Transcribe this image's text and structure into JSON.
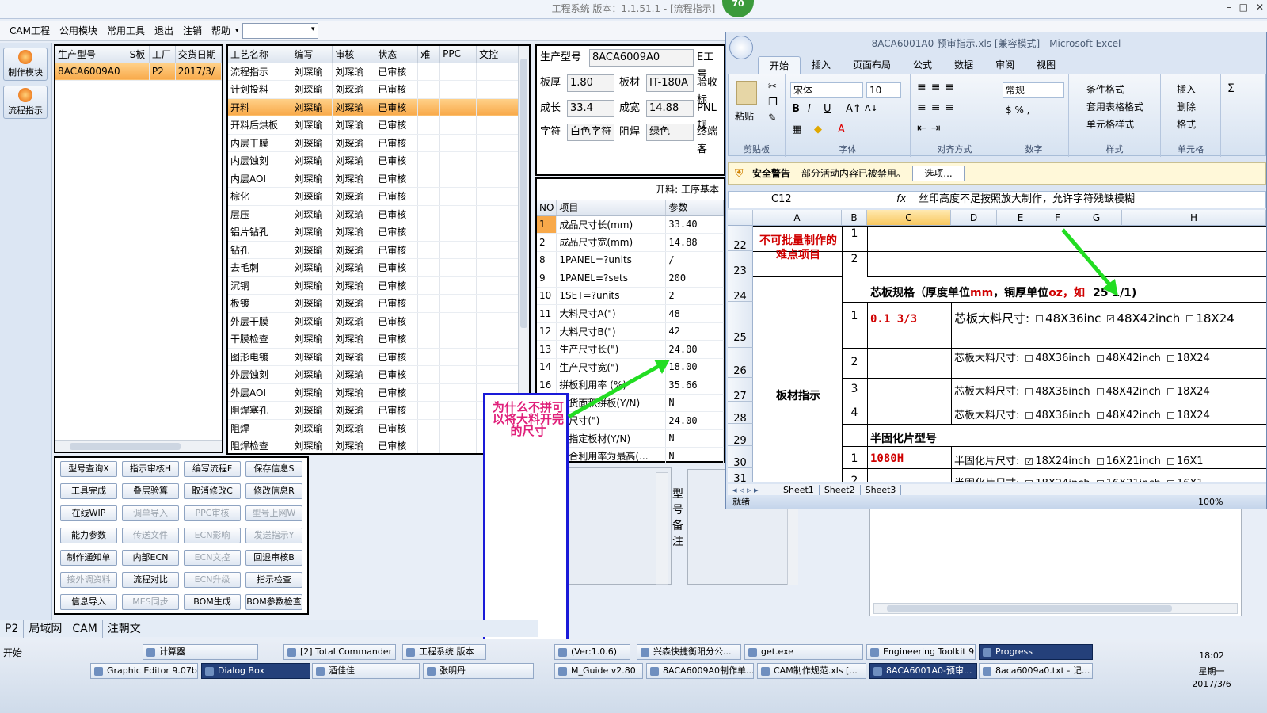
{
  "app": {
    "title": "工程系统   版本：1.1.51.1 - [流程指示]",
    "badge": "70",
    "win_controls": [
      "–",
      "□",
      "✕"
    ]
  },
  "menu": {
    "items": [
      "CAM工程",
      "公用模块",
      "常用工具",
      "退出",
      "注销",
      "帮助"
    ],
    "dropdown_arrow": "▾",
    "combo_value": ""
  },
  "left_buttons": [
    {
      "label": "制作模块"
    },
    {
      "label": "流程指示"
    }
  ],
  "order_grid": {
    "headers": [
      "生产型号",
      "S板",
      "工厂",
      "交货日期"
    ],
    "rows": [
      [
        "8ACA6009A0",
        "",
        "P2",
        "2017/3/"
      ]
    ]
  },
  "process_grid": {
    "headers": [
      "工艺名称",
      "编写",
      "审核",
      "状态",
      "难",
      "PPC",
      "文控"
    ],
    "rows": [
      [
        "流程指示",
        "刘琛瑜",
        "刘琛瑜",
        "已审核"
      ],
      [
        "计划投料",
        "刘琛瑜",
        "刘琛瑜",
        "已审核"
      ],
      [
        "开料",
        "刘琛瑜",
        "刘琛瑜",
        "已审核"
      ],
      [
        "开料后烘板",
        "刘琛瑜",
        "刘琛瑜",
        "已审核"
      ],
      [
        "内层干膜",
        "刘琛瑜",
        "刘琛瑜",
        "已审核"
      ],
      [
        "内层蚀刻",
        "刘琛瑜",
        "刘琛瑜",
        "已审核"
      ],
      [
        "内层AOI",
        "刘琛瑜",
        "刘琛瑜",
        "已审核"
      ],
      [
        "棕化",
        "刘琛瑜",
        "刘琛瑜",
        "已审核"
      ],
      [
        "层压",
        "刘琛瑜",
        "刘琛瑜",
        "已审核"
      ],
      [
        "铝片钻孔",
        "刘琛瑜",
        "刘琛瑜",
        "已审核"
      ],
      [
        "钻孔",
        "刘琛瑜",
        "刘琛瑜",
        "已审核"
      ],
      [
        "去毛刺",
        "刘琛瑜",
        "刘琛瑜",
        "已审核"
      ],
      [
        "沉铜",
        "刘琛瑜",
        "刘琛瑜",
        "已审核"
      ],
      [
        "板镀",
        "刘琛瑜",
        "刘琛瑜",
        "已审核"
      ],
      [
        "外层干膜",
        "刘琛瑜",
        "刘琛瑜",
        "已审核"
      ],
      [
        "干膜检查",
        "刘琛瑜",
        "刘琛瑜",
        "已审核"
      ],
      [
        "图形电镀",
        "刘琛瑜",
        "刘琛瑜",
        "已审核"
      ],
      [
        "外层蚀刻",
        "刘琛瑜",
        "刘琛瑜",
        "已审核"
      ],
      [
        "外层AOI",
        "刘琛瑜",
        "刘琛瑜",
        "已审核"
      ],
      [
        "阻焊塞孔",
        "刘琛瑜",
        "刘琛瑜",
        "已审核"
      ],
      [
        "阻焊",
        "刘琛瑜",
        "刘琛瑜",
        "已审核"
      ],
      [
        "阻焊检查",
        "刘琛瑜",
        "刘琛瑜",
        "已审核"
      ]
    ],
    "selected_index": 2
  },
  "buttons": [
    [
      "型号查询X",
      "指示审核H",
      "编写流程F",
      "保存信息S"
    ],
    [
      "工具完成",
      "叠层验算",
      "取消修改C",
      "修改信息R"
    ],
    [
      "在线WIP",
      "调单导入",
      "PPC审核",
      "型号上网W"
    ],
    [
      "能力参数",
      "传送文件",
      "ECN影响",
      "发送指示Y"
    ],
    [
      "制作通知单",
      "内部ECN",
      "ECN文控",
      "回退审核B"
    ],
    [
      "接外调资料",
      "流程对比",
      "ECN升级",
      "指示检查"
    ],
    [
      "信息导入",
      "MES同步",
      "BOM生成",
      "BOM参数检查"
    ]
  ],
  "disabled_buttons": [
    "调单导入",
    "PPC审核",
    "型号上网W",
    "传送文件",
    "ECN影响",
    "发送指示Y",
    "ECN文控",
    "接外调资料",
    "ECN升级",
    "MES同步"
  ],
  "info": {
    "prod_label": "生产型号",
    "prod_value": "8ACA6009A0",
    "e_label": "E工号",
    "thick_label": "板厚",
    "thick_value": "1.80",
    "mat_label": "板材",
    "mat_value": "IT-180A",
    "check_label": "验收标",
    "len_label": "成长",
    "len_value": "33.4",
    "wid_label": "成宽",
    "wid_value": "14.88",
    "pnl_label": "PNL规",
    "char_label": "字符",
    "char_value": "白色字符",
    "mask_label": "阻焊",
    "mask_value": "绿色",
    "end_label": "终端客"
  },
  "param_grid": {
    "title": "开料: 工序基本",
    "headers": [
      "NO",
      "项目",
      "参数"
    ],
    "rows": [
      [
        "1",
        "成品尺寸长(mm)",
        "33.40"
      ],
      [
        "2",
        "成品尺寸宽(mm)",
        "14.88"
      ],
      [
        "8",
        "1PANEL=?units",
        "/"
      ],
      [
        "9",
        "1PANEL=?sets",
        "200"
      ],
      [
        "10",
        "1SET=?units",
        "2"
      ],
      [
        "11",
        "大料尺寸A(\")",
        "48"
      ],
      [
        "12",
        "大料尺寸B(\")",
        "42"
      ],
      [
        "13",
        "生产尺寸长(\")",
        "24.00"
      ],
      [
        "14",
        "生产尺寸宽(\")",
        "18.00"
      ],
      [
        "16",
        "拼板利用率 (%)",
        "35.66"
      ],
      [
        "",
        "交货面积拼板(Y/N)",
        "N"
      ],
      [
        "",
        "间尺寸(\")",
        "24.00"
      ],
      [
        "",
        "客指定板材(Y/N)",
        "N"
      ],
      [
        "",
        "综合利用率为最高(...",
        "N"
      ]
    ],
    "selected_index": 0
  },
  "remarks_label": "型号备注",
  "excel": {
    "title": "8ACA6001A0-预审指示.xls  [兼容模式] - Microsoft Excel",
    "tabs": [
      "开始",
      "插入",
      "页面布局",
      "公式",
      "数据",
      "审阅",
      "视图"
    ],
    "groups": [
      "剪贴板",
      "字体",
      "对齐方式",
      "数字",
      "样式",
      "单元格"
    ],
    "paste": "粘贴",
    "font_name": "宋体",
    "font_size": "10",
    "num_format": "常规",
    "style_items": [
      "条件格式",
      "套用表格格式",
      "单元格样式"
    ],
    "cell_items": [
      "插入",
      "删除",
      "格式"
    ],
    "security_title": "安全警告",
    "security_text": "部分活动内容已被禁用。",
    "options_btn": "选项...",
    "name_box": "C12",
    "fx": "fx",
    "formula": "丝印高度不足按照放大制作，允许字符残缺模糊",
    "cols": [
      "A",
      "B",
      "C",
      "D",
      "E",
      "F",
      "G",
      "H"
    ],
    "rows": [
      "22",
      "23",
      "24",
      "25",
      "26",
      "27",
      "28",
      "29",
      "30",
      "31"
    ],
    "a_difficult": "不可批量制作的难点项目",
    "a_board": "板材指示",
    "b_values": [
      "1",
      "2",
      "1",
      "2",
      "3",
      "4",
      "1",
      "2"
    ],
    "core_spec_a": "芯板规格（厚度单位",
    "core_spec_mm": "mm",
    "core_spec_b": "，铜厚单位",
    "core_spec_oz": "oz",
    "core_spec_c": "，如",
    "core_spec_d": "25 1/1)",
    "core_label": "芯板大料尺寸:",
    "core_first_value": "0.1 3/3",
    "opt_48x36": "48X36inch",
    "opt_48x36_cut": "48X36inc",
    "opt_48x42": "48X42inch",
    "opt_18x24_cut": "18X24",
    "pp_header": "半固化片型号",
    "pp_label": "半固化片尺寸:",
    "pp_first_value": "1080H",
    "opt_18x24": "18X24inch",
    "opt_16x21": "16X21inch",
    "opt_16x1_cut": "16X1",
    "sheets": [
      "Sheet1",
      "Sheet2",
      "Sheet3"
    ],
    "status": "就绪",
    "zoom": "100%"
  },
  "overlay": {
    "note": "为什么不拼可以将大料开完的尺寸"
  },
  "bottom_tabs": [
    "P2",
    "局域网",
    "CAM",
    "注朝文"
  ],
  "taskbar": {
    "start": "开始",
    "row1": [
      "计算器",
      "[2] Total Commander ...",
      "工程系统  版本",
      "(Ver:1.0.6)",
      "兴森快捷衡阳分公...",
      "get.exe",
      "Engineering Toolkit 9....",
      "Progress"
    ],
    "row2": [
      "Graphic Editor 9.07b...",
      "Dialog Box",
      "酒佳佳",
      "张明丹",
      "M_Guide v2.80",
      "8ACA6009A0制作单...",
      "CAM制作规范.xls [...",
      "8ACA6001A0-预审...",
      "8aca6009a0.txt - 记..."
    ],
    "time": "18:02",
    "weekday": "星期一",
    "date": "2017/3/6"
  },
  "colors": {
    "selected_row": "#f8a94a",
    "annotation_blue": "#1a1ad8",
    "annotation_pink": "#e0207a",
    "arrow_green": "#22dd22",
    "excel_red": "#d00000"
  }
}
